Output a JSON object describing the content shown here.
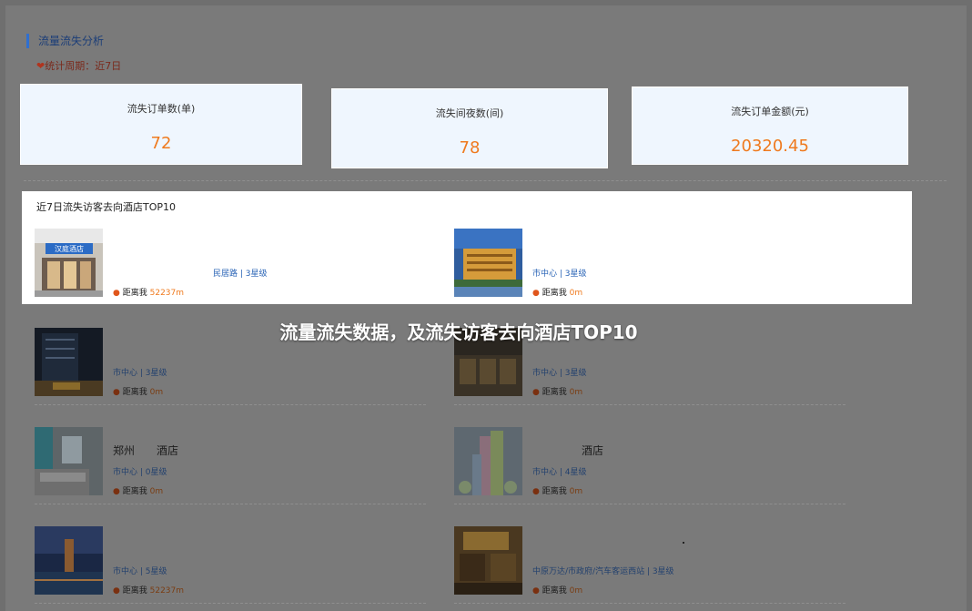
{
  "section": {
    "title": "流量流失分析",
    "period": "统计周期：近7日"
  },
  "stats": [
    {
      "label": "流失订单数(单)",
      "value": "72"
    },
    {
      "label": "流失间夜数(间)",
      "value": "78"
    },
    {
      "label": "流失订单金额(元)",
      "value": "20320.45"
    }
  ],
  "top10": {
    "title": "近7日流失访客去向酒店TOP10",
    "distance_prefix": "距离我",
    "hotels": [
      {
        "name": "",
        "area": "民居路 | 3星级",
        "distance": "52237m"
      },
      {
        "name": "",
        "area": "市中心 | 3星级",
        "distance": "0m"
      },
      {
        "name": "",
        "area": "市中心 | 3星级",
        "distance": "0m"
      },
      {
        "name": "",
        "area": "市中心 | 3星级",
        "distance": "0m"
      },
      {
        "name": "郑州　　酒店",
        "area": "市中心 | 0星级",
        "distance": "0m"
      },
      {
        "name": "酒店",
        "area": "市中心 | 4星级",
        "distance": "0m"
      },
      {
        "name": "",
        "area": "市中心 | 5星级",
        "distance": "52237m"
      },
      {
        "name": "",
        "area": "中原万达/市政府/汽车客运西站 | 3星级",
        "distance": "0m"
      }
    ]
  },
  "caption": "流量流失数据，及流失访客去向酒店TOP10",
  "colors": {
    "accent": "#ef7a1e",
    "link": "#2a64b6",
    "card_bg": "#eff6fe",
    "title_bar": "#2f6fd0"
  }
}
